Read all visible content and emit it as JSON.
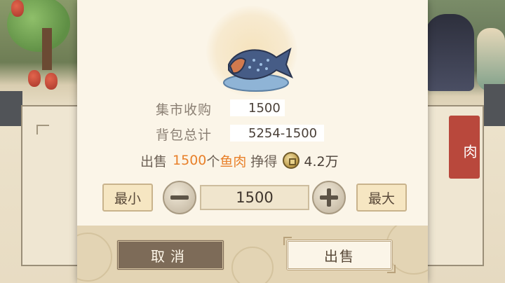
{
  "background": {
    "meat_tag": "肉"
  },
  "dialog": {
    "item_icon": "fish-meat-icon",
    "market_buy_label": "集市收购",
    "market_buy_value": "1500",
    "bag_total_label": "背包总计",
    "bag_total_value": "5254-1500",
    "sell_prefix": "出售",
    "sell_quantity": "1500",
    "sell_unit": "个",
    "sell_item": "鱼肉",
    "earn_label": "挣得",
    "coin_icon": "copper-coin-icon",
    "earn_amount": "4.2万",
    "min_label": "最小",
    "max_label": "最大",
    "quantity_value": "1500",
    "cancel_label": "取消",
    "sell_label": "出售"
  },
  "colors": {
    "highlight": "#e8802a",
    "cancel_button": "#7d6b58",
    "panel": "#fbf5e8"
  }
}
